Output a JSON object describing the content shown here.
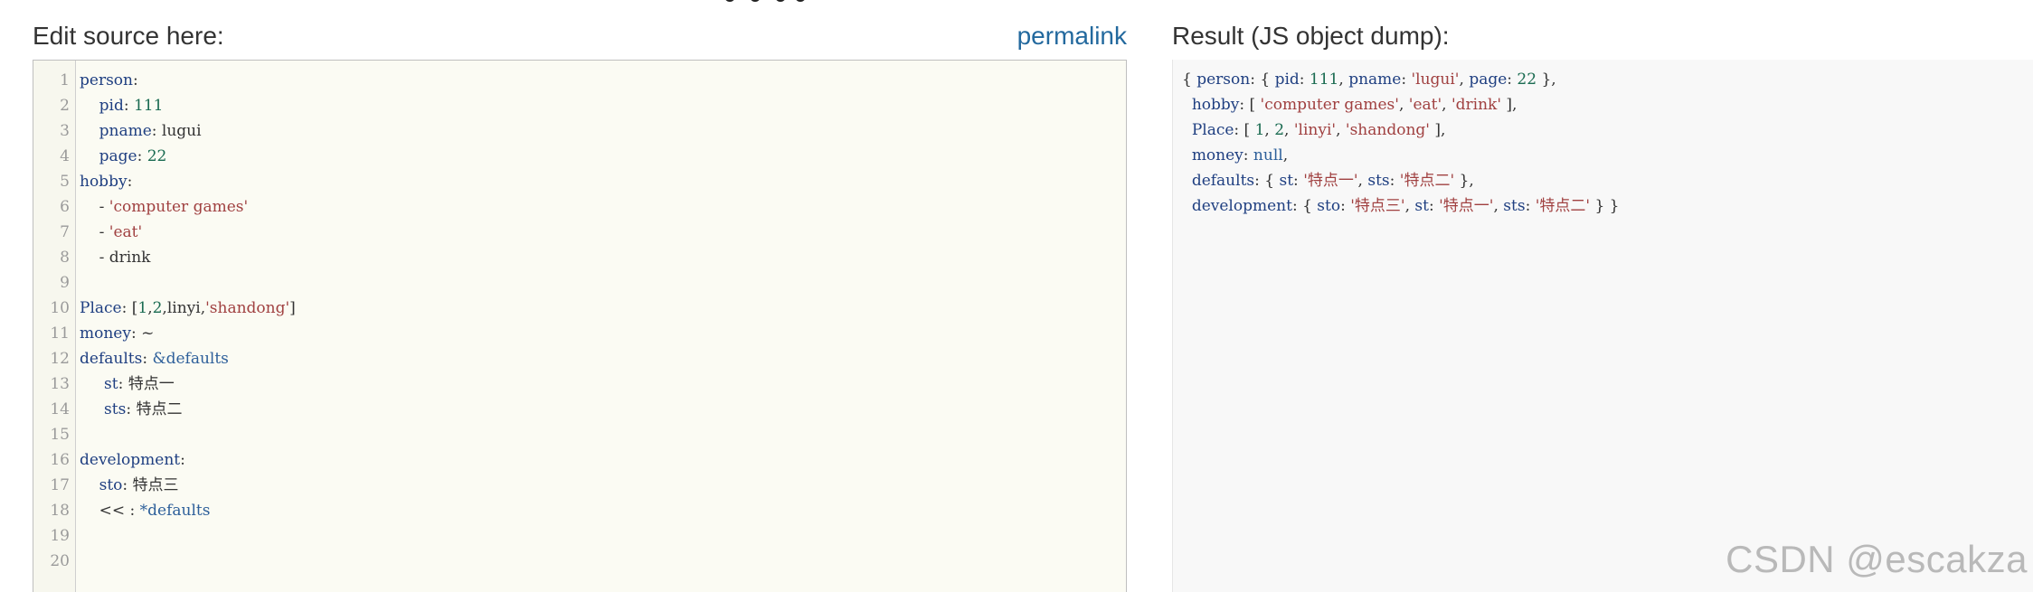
{
  "headings": {
    "editor": "Edit source here:",
    "permalink": "permalink",
    "result": "Result (JS object dump):"
  },
  "editor": {
    "line_numbers": [
      "1",
      "2",
      "3",
      "4",
      "5",
      "6",
      "7",
      "8",
      "9",
      "10",
      "11",
      "12",
      "13",
      "14",
      "15",
      "16",
      "17",
      "18",
      "19",
      "20"
    ],
    "lines": [
      "person:",
      "    pid: 111",
      "    pname: lugui",
      "    page: 22",
      "hobby:",
      "    - 'computer games'",
      "    - 'eat'",
      "    - drink",
      "",
      "Place: [1,2,linyi,'shandong']",
      "money: ~",
      "defaults: &defaults",
      "     st: 特点一",
      "     sts: 特点二",
      "",
      "development:",
      "    sto: 特点三",
      "    << : *defaults",
      "",
      ""
    ]
  },
  "result": {
    "lines": [
      "{ person: { pid: 111, pname: 'lugui', page: 22 },",
      "  hobby: [ 'computer games', 'eat', 'drink' ],",
      "  Place: [ 1, 2, 'linyi', 'shandong' ],",
      "  money: null,",
      "  defaults: { st: '特点一', sts: '特点二' },",
      "  development: { sto: '特点三', st: '特点一', sts: '特点二' } }"
    ]
  },
  "watermark": "CSDN @escakza",
  "colors": {
    "key": "#1f3f81",
    "number": "#1a6b51",
    "string": "#a04040",
    "anchor": "#2d5f9a",
    "permalink": "#23699e"
  }
}
